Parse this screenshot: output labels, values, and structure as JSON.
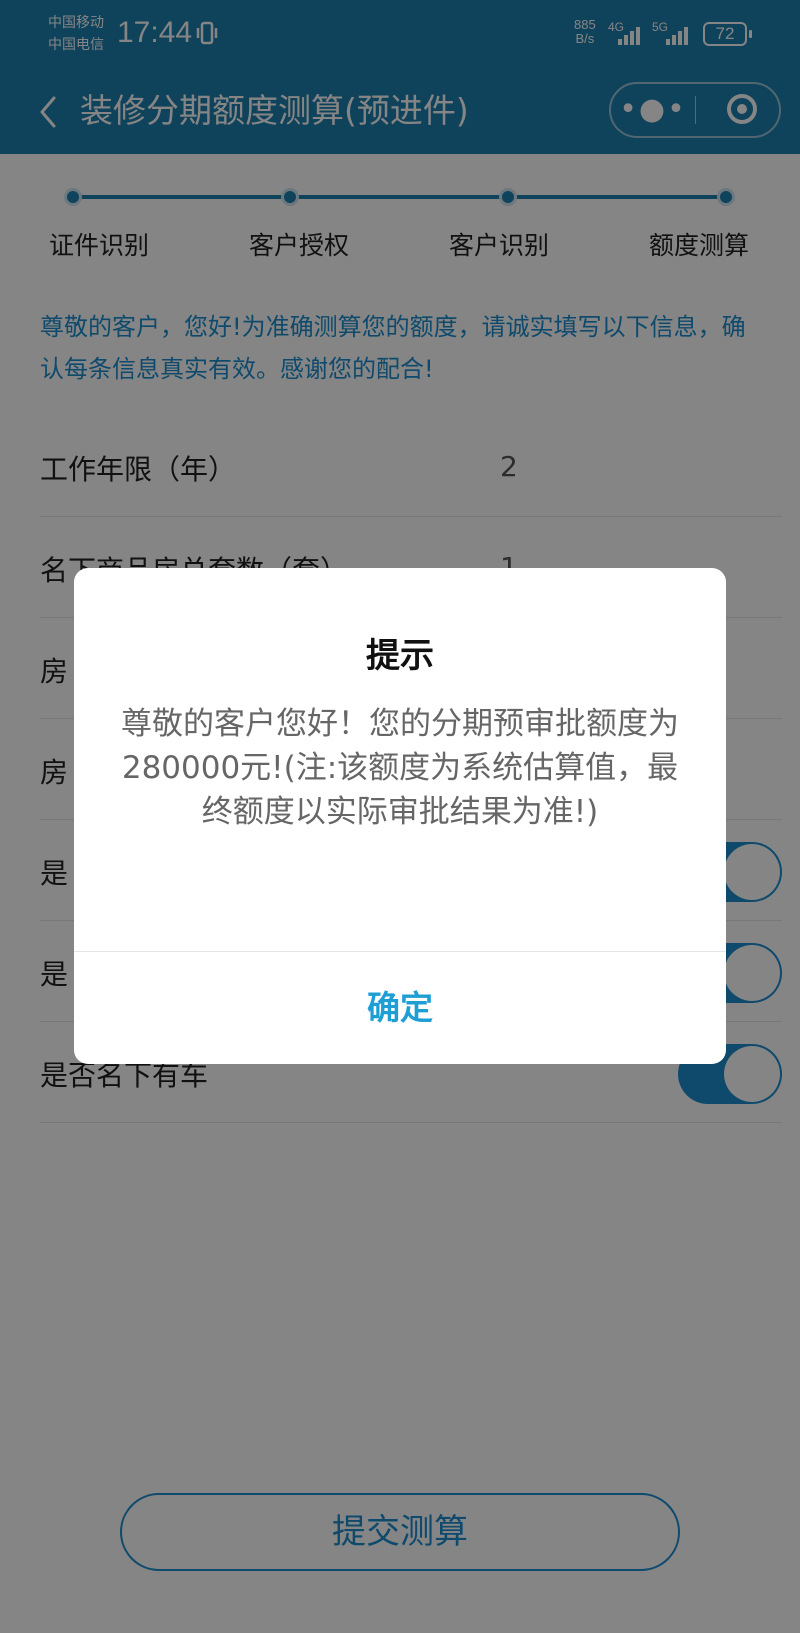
{
  "status_bar": {
    "carrier_1": "中国移动",
    "carrier_2": "中国电信",
    "time": "17:44",
    "net_speed_value": "885",
    "net_speed_unit": "B/s",
    "signal_1_label": "4G",
    "signal_2_label": "5G",
    "battery": "72"
  },
  "header": {
    "title": "装修分期额度测算(预进件)",
    "more_icon": "more-dots-icon",
    "close_icon": "mini-program-close-icon"
  },
  "stepper": {
    "steps": [
      "证件识别",
      "客户授权",
      "客户识别",
      "额度测算"
    ]
  },
  "notice": "尊敬的客户，您好!为准确测算您的额度，请诚实填写以下信息，确认每条信息真实有效。感谢您的配合!",
  "form": {
    "rows": [
      {
        "label": "工作年限（年）",
        "value": "2"
      },
      {
        "label": "名下商品房总套数（套）",
        "value": "1"
      },
      {
        "label": "房",
        "value": ""
      },
      {
        "label": "房",
        "value": ""
      },
      {
        "label": "是",
        "toggle": true
      },
      {
        "label": "是",
        "toggle": true
      },
      {
        "label": "是否名下有车",
        "toggle": true
      }
    ]
  },
  "submit_label": "提交测算",
  "dialog": {
    "title": "提示",
    "message": "尊敬的客户您好！您的分期预审批额度为280000元!(注:该额度为系统估算值，最终额度以实际审批结果为准!)",
    "confirm_label": "确定"
  },
  "colors": {
    "brand": "#1d7fae",
    "accent": "#1d9fd6"
  }
}
